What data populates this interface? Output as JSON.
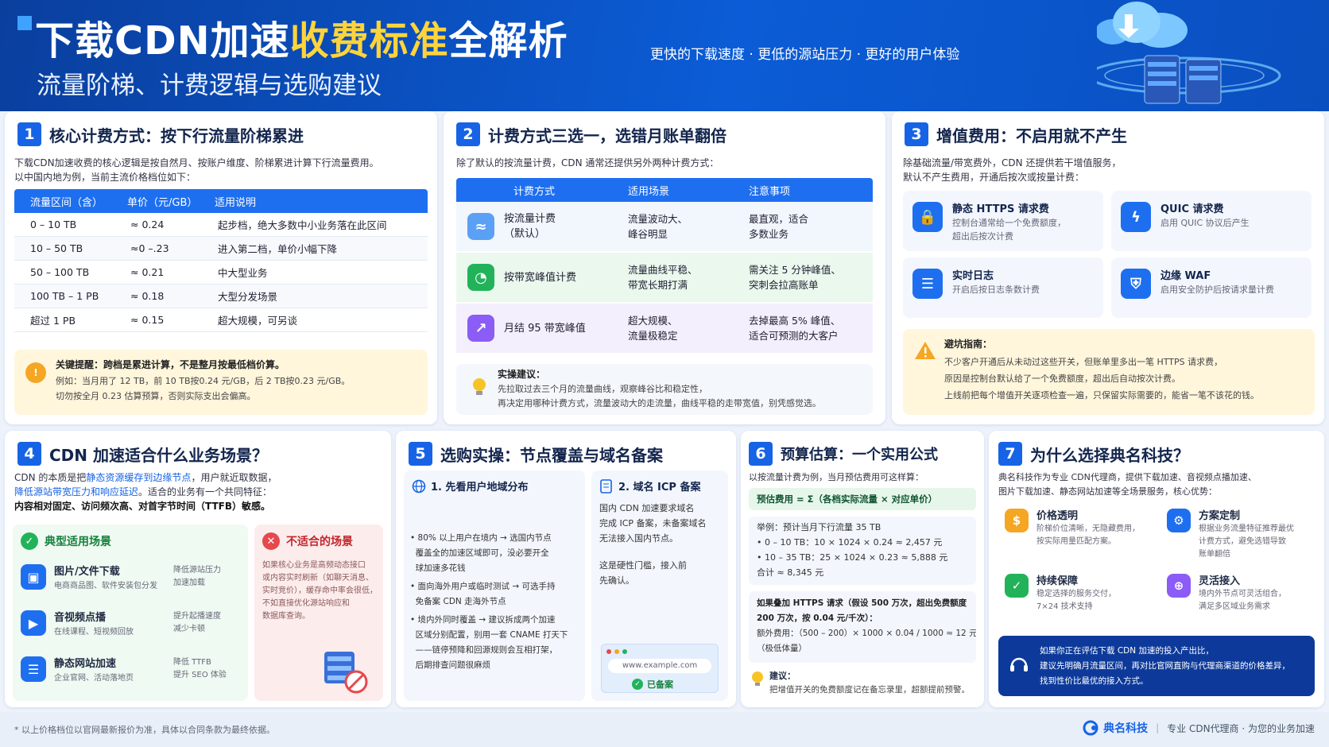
{
  "header": {
    "title_a": "下载CDN加速",
    "title_b": "收费标准",
    "title_c": "全解析",
    "subtitle": "流量阶梯、计费逻辑与选购建议",
    "tagline": "更快的下载速度 · 更低的源站压力 · 更好的用户体验"
  },
  "s1": {
    "num": "1",
    "title": "核心计费方式：按下行流量阶梯累进",
    "desc1": "下载CDN加速收费的核心逻辑是按自然月、按账户维度、阶梯累进计算下行流量费用。",
    "desc2": "以中国内地为例，当前主流价格档位如下：",
    "headers": [
      "流量区间（含）",
      "单价（元/GB）",
      "适用说明"
    ],
    "rows": [
      [
        "0 – 10 TB",
        "≈ 0.24",
        "起步档，绝大多数中小业务落在此区间"
      ],
      [
        "10 – 50 TB",
        "≈0 –.23",
        "进入第二档，单价小幅下降"
      ],
      [
        "50 – 100 TB",
        "≈ 0.21",
        "中大型业务"
      ],
      [
        "100 TB – 1 PB",
        "≈ 0.18",
        "大型分发场景"
      ],
      [
        "超过 1 PB",
        "≈ 0.15",
        "超大规模，可另谈"
      ]
    ],
    "tip_title": "关键提醒：跨档是累进计算，不是整月按最低档价算。",
    "tip_l1": "例如：当月用了 12 TB，前 10 TB按0.24 元/GB，后 2 TB按0.23 元/GB。",
    "tip_l2": "切勿按全月 0.23 估算预算，否则实际支出会偏高。"
  },
  "s2": {
    "num": "2",
    "title": "计费方式三选一，选错月账单翻倍",
    "desc": "除了默认的按流量计费，CDN 通常还提供另外两种计费方式：",
    "headers": [
      "计费方式",
      "适用场景",
      "注意事项"
    ],
    "rows": [
      {
        "name": "按流量计费\n（默认）",
        "scene": "流量波动大、\n峰谷明显",
        "note": "最直观，适合\n多数业务"
      },
      {
        "name": "按带宽峰值计费",
        "scene": "流量曲线平稳、\n带宽长期打满",
        "note": "需关注 5 分钟峰值、\n突刺会拉高账单"
      },
      {
        "name": "月结 95 带宽峰值",
        "scene": "超大规模、\n流量极稳定",
        "note": "去掉最高 5% 峰值、\n适合可预测的大客户"
      }
    ],
    "tip_title": "实操建议：",
    "tip_l1": "先拉取过去三个月的流量曲线，观察峰谷比和稳定性，",
    "tip_l2": "再决定用哪种计费方式，流量波动大的走流量，曲线平稳的走带宽值，别凭感觉选。"
  },
  "s3": {
    "num": "3",
    "title": "增值费用：不启用就不产生",
    "desc1": "除基础流量/带宽费外，CDN 还提供若干增值服务，",
    "desc2": "默认不产生费用，开通后按次或按量计费：",
    "items": [
      {
        "name": "静态 HTTPS 请求费",
        "sub": "控制台通常给一个免费额度，\n超出后按次计费"
      },
      {
        "name": "QUIC 请求费",
        "sub": "启用 QUIC 协议后产生"
      },
      {
        "name": "实时日志",
        "sub": "开启后按日志条数计费"
      },
      {
        "name": "边缘 WAF",
        "sub": "启用安全防护后按请求量计费"
      }
    ],
    "warn_title": "避坑指南：",
    "warn_l1": "不少客户开通后从未动过这些开关，但账单里多出一笔 HTTPS 请求费，",
    "warn_l2": "原因是控制台默认给了一个免费额度，超出后自动按次计费。",
    "warn_l3": "上线前把每个增值开关逐项检查一遍，只保留实际需要的，能省一笔不该花的钱。"
  },
  "s4": {
    "num": "4",
    "title": "CDN 加速适合什么业务场景？",
    "d1a": "CDN 的本质是把",
    "d1b": "静态资源缓存到边缘节点",
    "d1c": "，用户就近取数据，",
    "d2a": "降低源站带宽压力和响应延迟",
    "d2b": "。适合的业务有一个共同特征：",
    "d3": "内容相对固定、访问频次高、对首字节时间（TTFB）敏感。",
    "good_title": "典型适用场景",
    "good": [
      {
        "name": "图片/文件下载",
        "sub": "电商商品图、软件安装包分发",
        "benefit": "降低源站压力\n加速加载"
      },
      {
        "name": "音视频点播",
        "sub": "在线课程、短视频回放",
        "benefit": "提升起播速度\n减少卡顿"
      },
      {
        "name": "静态网站加速",
        "sub": "企业官网、活动落地页",
        "benefit": "降低 TTFB\n提升 SEO 体验"
      }
    ],
    "bad_title": "不适合的场景",
    "bad_text": "如果核心业务是高频动态接口\n或内容实时刷新（如聊天消息、\n实时竞价），缓存命中率会很低，\n不如直接优化源站响应和\n数据库查询。"
  },
  "s5": {
    "num": "5",
    "title": "选购实操：节点覆盖与域名备案",
    "a_title": "1. 先看用户地域分布",
    "a_b1": "• 80% 以上用户在境内 → 选国内节点\n  覆盖全的加速区域即可，没必要开全\n  球加速多花钱",
    "a_b2": "• 面向海外用户或临时测试 → 可选手持\n  免备案 CDN 走海外节点",
    "a_b3": "• 境内外同时覆盖 → 建议拆成两个加速\n  区域分别配置，别用一套 CNAME 打天下\n  ——链停预降和回源规则会互相打架，\n  后期排查问题很麻烦",
    "b_title": "2. 域名 ICP 备案",
    "b_text": "国内 CDN 加速要求域名\n完成 ICP 备案，未备案域名\n无法接入国内节点。",
    "b_text2": "这是硬性门槛，接入前\n先确认。",
    "url": "www.example.com",
    "badge": "已备案"
  },
  "s6": {
    "num": "6",
    "title": "预算估算：一个实用公式",
    "desc": "以按流量计费为例，当月预估费用可这样算：",
    "formula": "预估费用 = Σ（各档实际流量 × 对应单价）",
    "ex_title": "举例：预计当月下行流量 35 TB",
    "ex_l1": "• 0 – 10 TB：10 × 1024 × 0.24 ≈ 2,457 元",
    "ex_l2": "• 10 – 35 TB：25 × 1024 × 0.23 ≈ 5,888 元",
    "ex_total": "合计 ≈ 8,345 元",
    "https_l1": "如果叠加 HTTPS 请求（假设 500 万次，超出免费额度",
    "https_l2": "200 万次，按 0.04 元/千次）：",
    "https_l3": "额外费用：（500 – 200）× 1000 × 0.04 / 1000 ≈ 12 元",
    "https_l4": "（极低体量）",
    "tip_title": "建议：",
    "tip_text": "把增值开关的免费额度记在备忘录里，超额提前预警。"
  },
  "s7": {
    "num": "7",
    "title": "为什么选择典名科技？",
    "desc1": "典名科技作为专业 CDN代理商，提供下载加速、音视频点播加速、",
    "desc2": "图片下载加速、静态网站加速等全场景服务，核心优势：",
    "items": [
      {
        "name": "价格透明",
        "sub": "阶梯价位清晰，无隐藏费用，\n按实际用量匹配方案。"
      },
      {
        "name": "方案定制",
        "sub": "根据业务流量特征推荐最优\n计费方式，避免选错导致\n账单翻倍"
      },
      {
        "name": "持续保障",
        "sub": "稳定选择的服务交付，\n7×24 技术支持"
      },
      {
        "name": "灵活接入",
        "sub": "境内外节点可灵活组合，\n满足多区域业务需求"
      }
    ],
    "cta_l1": "如果你正在评估下载 CDN 加速的投入产出比，",
    "cta_l2": "建议先明确月流量区间，再对比官网直购与代理商渠道的价格差异，",
    "cta_l3": "找到性价比最优的接入方式。"
  },
  "footer": {
    "note": "* 以上价格档位以官网最新报价为准，具体以合同条款为最终依据。",
    "brand": "典名科技",
    "brand_sub": "专业 CDN代理商 · 为您的业务加速"
  },
  "colors": {
    "primary": "#1763e6",
    "yellow": "#ffd43b",
    "green": "#22b35a",
    "red": "#e5484d",
    "purple": "#8b5cf6"
  }
}
